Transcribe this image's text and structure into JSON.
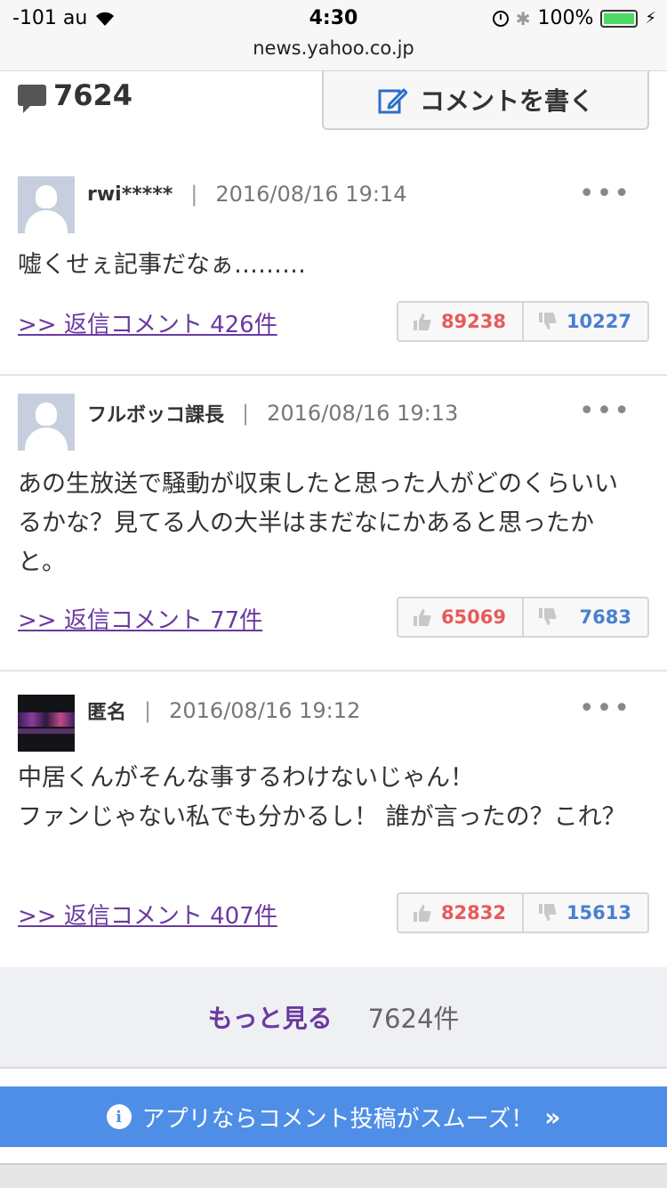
{
  "status": {
    "carrier": "-101 au",
    "time": "4:30",
    "battery": "100%",
    "url": "news.yahoo.co.jp"
  },
  "header": {
    "comment_count": "7624",
    "write_label": "コメントを書く"
  },
  "comments": [
    {
      "author": "rwi*****",
      "date": "2016/08/16 19:14",
      "body": "嘘くせぇ記事だなぁ………",
      "reply_link": ">> 返信コメント 426件",
      "likes": "89238",
      "dislikes": "10227"
    },
    {
      "author": "フルボッコ課長",
      "date": "2016/08/16 19:13",
      "body": "あの生放送で騒動が収束したと思った人がどのくらいいるかな？見てる人の大半はまだなにかあると思ったかと。",
      "reply_link": ">> 返信コメント 77件",
      "likes": "65069",
      "dislikes": "7683"
    },
    {
      "author": "匿名",
      "date": "2016/08/16 19:12",
      "body": "中居くんがそんな事するわけないじゃん！\nファンじゃない私でも分かるし！ 誰が言ったの？これ？",
      "reply_link": ">> 返信コメント 407件",
      "likes": "82832",
      "dislikes": "15613"
    }
  ],
  "more": {
    "label": "もっと見る",
    "total": "7624件"
  },
  "app_banner": {
    "text": "アプリならコメント投稿がスムーズ！"
  },
  "icons": [
    "wifi-icon",
    "alarm-icon",
    "bluetooth-icon",
    "battery-icon",
    "comment-bubble-icon",
    "pen-icon",
    "more-icon",
    "thumbs-up-icon",
    "thumbs-down-icon",
    "info-icon",
    "double-chevron-icon"
  ]
}
